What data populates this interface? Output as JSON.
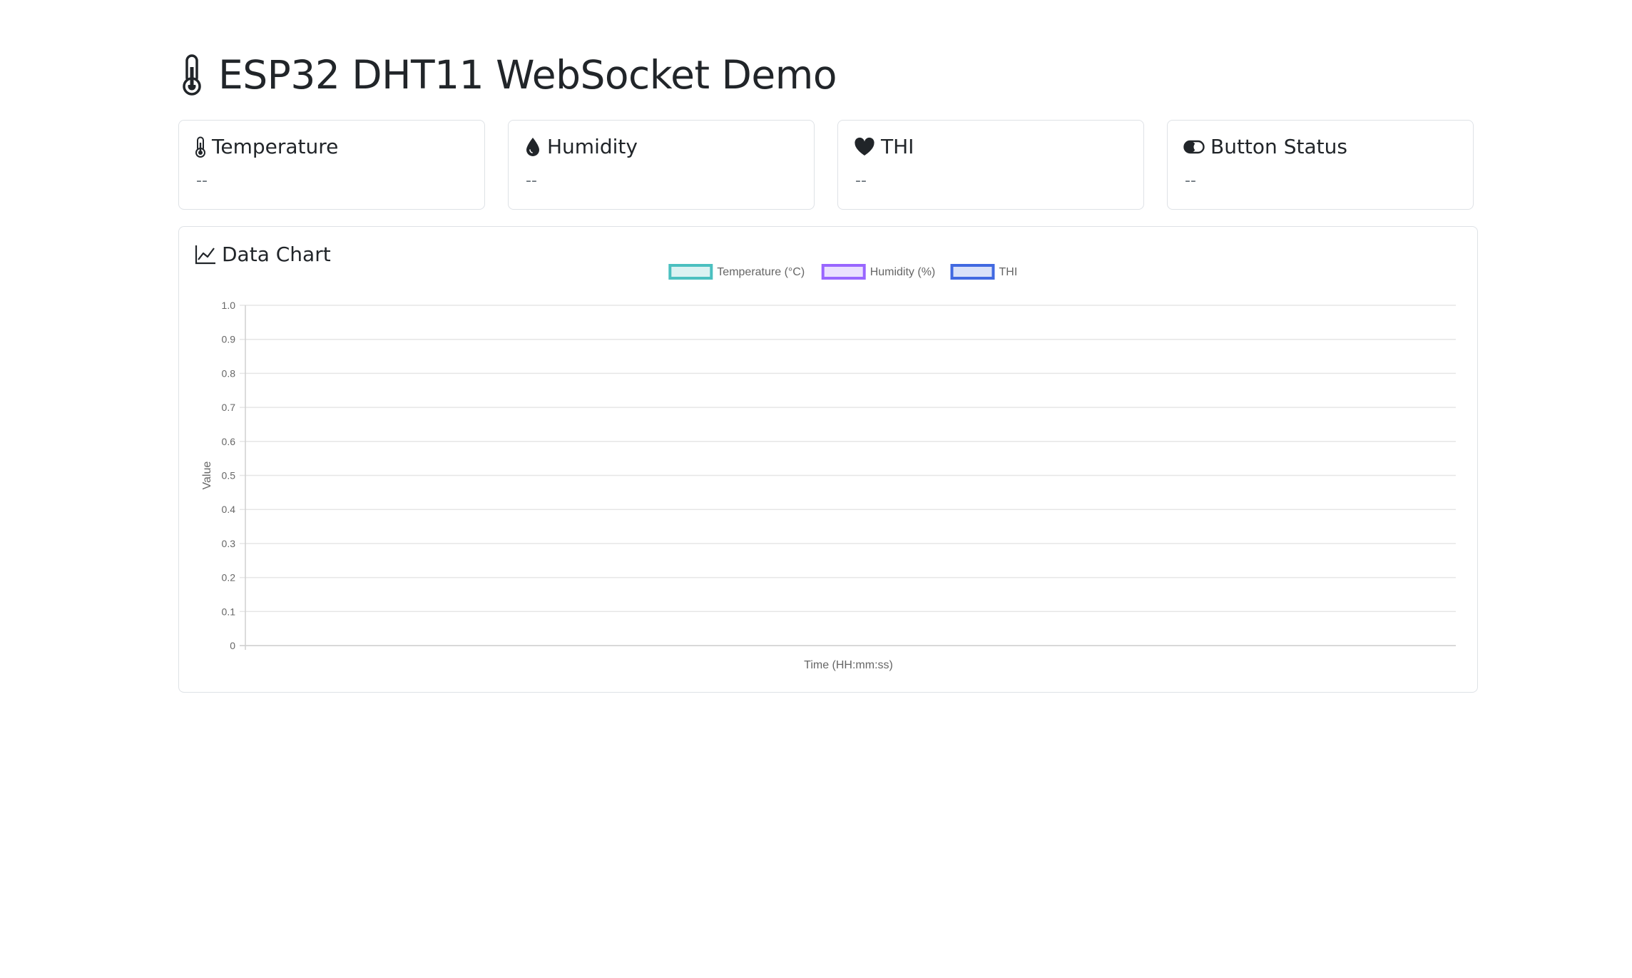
{
  "page": {
    "title": "ESP32 DHT11 WebSocket Demo",
    "title_icon": "thermometer-icon"
  },
  "cards": [
    {
      "key": "temperature",
      "label": "Temperature",
      "value": "--",
      "icon": "thermometer-icon"
    },
    {
      "key": "humidity",
      "label": "Humidity",
      "value": "--",
      "icon": "droplet-icon"
    },
    {
      "key": "thi",
      "label": "THI",
      "value": "--",
      "icon": "heart-icon"
    },
    {
      "key": "button",
      "label": "Button Status",
      "value": "--",
      "icon": "toggle-icon"
    }
  ],
  "chart_section": {
    "title": "Data Chart",
    "icon": "line-chart-icon"
  },
  "chart_data": {
    "type": "line",
    "xlabel": "Time (HH:mm:ss)",
    "ylabel": "Value",
    "ylim": [
      0,
      1
    ],
    "yticks": [
      "0",
      "0.1",
      "0.2",
      "0.3",
      "0.4",
      "0.5",
      "0.6",
      "0.7",
      "0.8",
      "0.9",
      "1.0"
    ],
    "x": [],
    "grid": true,
    "legend_position": "top",
    "series": [
      {
        "name": "Temperature (°C)",
        "values": [],
        "border": "#4bc0c0",
        "fill": "#dbf2f2"
      },
      {
        "name": "Humidity (%)",
        "values": [],
        "border": "#9966ff",
        "fill": "#ebe0ff"
      },
      {
        "name": "THI",
        "values": [],
        "border": "#4169e1",
        "fill": "#d9e1f9"
      }
    ]
  }
}
